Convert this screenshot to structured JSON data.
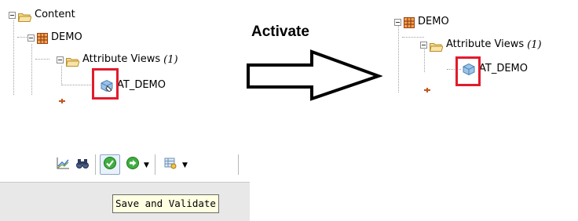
{
  "left_tree": {
    "root_label": "Content",
    "package_label": "DEMO",
    "folder_label": "Attribute Views",
    "folder_count": "(1)",
    "view_label": "AT_DEMO"
  },
  "activate_label": "Activate",
  "right_tree": {
    "package_label": "DEMO",
    "folder_label": "Attribute Views",
    "folder_count": "(1)",
    "view_label": "AT_DEMO"
  },
  "toolbar": {
    "buttons": [
      {
        "icon": "chart-icon"
      },
      {
        "icon": "binoculars-icon"
      },
      {
        "icon": "save-and-validate-icon",
        "state": "hovered"
      },
      {
        "icon": "activate-arrow-icon"
      },
      {
        "icon": "data-preview-icon"
      }
    ]
  },
  "tooltip_text": "Save and Validate",
  "colors": {
    "highlight": "#e21b2b",
    "folder": "#e6c36a",
    "package": "#c2541f",
    "check_green": "#3fae3f",
    "tooltip_bg": "#ffffe1"
  }
}
